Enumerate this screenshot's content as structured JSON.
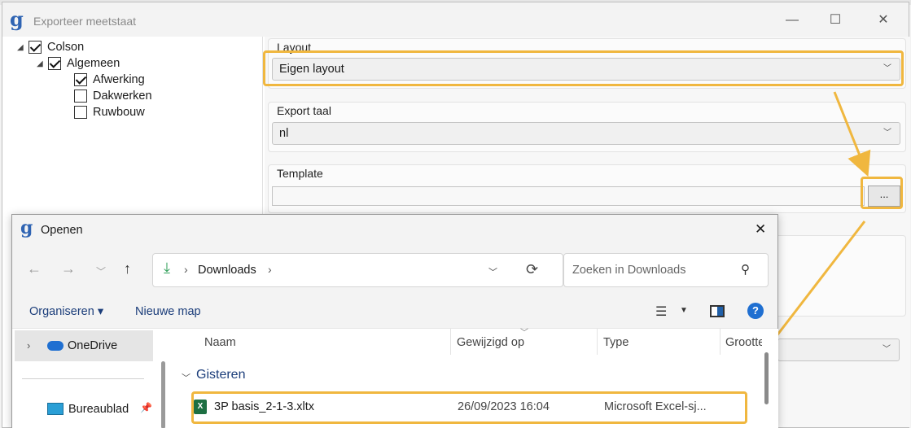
{
  "main_window": {
    "title": "Exporteer meetstaat",
    "logo": "g",
    "controls": {
      "minimize": "—",
      "maximize": "☐",
      "close": "✕"
    }
  },
  "tree": {
    "items": [
      {
        "label": "Colson",
        "checked": true,
        "expander": true
      },
      {
        "label": "Algemeen",
        "checked": true,
        "expander": true
      },
      {
        "label": "Afwerking",
        "checked": true,
        "expander": false
      },
      {
        "label": "Dakwerken",
        "checked": false,
        "expander": false
      },
      {
        "label": "Ruwbouw",
        "checked": false,
        "expander": false
      }
    ]
  },
  "settings": {
    "layout_label": "Layout",
    "layout_value": "Eigen layout",
    "language_label": "Export taal",
    "language_value": "nl",
    "template_label": "Template",
    "template_value": "",
    "browse_label": "..."
  },
  "open_dialog": {
    "title": "Openen",
    "logo": "g",
    "close": "✕",
    "breadcrumb": "Downloads",
    "search_placeholder": "Zoeken in Downloads",
    "organize_label": "Organiseren ▾",
    "new_folder_label": "Nieuwe map",
    "help": "?",
    "nav_items": [
      {
        "label": "OneDrive"
      },
      {
        "label": "Bureaublad"
      }
    ],
    "columns": [
      "Naam",
      "Gewijzigd op",
      "Type",
      "Grootte"
    ],
    "group_label": "Gisteren",
    "files": [
      {
        "name": "3P basis_2-1-3.xltx",
        "modified": "26/09/2023 16:04",
        "type": "Microsoft Excel-sj..."
      }
    ]
  },
  "colors": {
    "highlight": "#f0b73f",
    "accent_blue": "#2f64b3",
    "excel_green": "#1d6f42"
  }
}
